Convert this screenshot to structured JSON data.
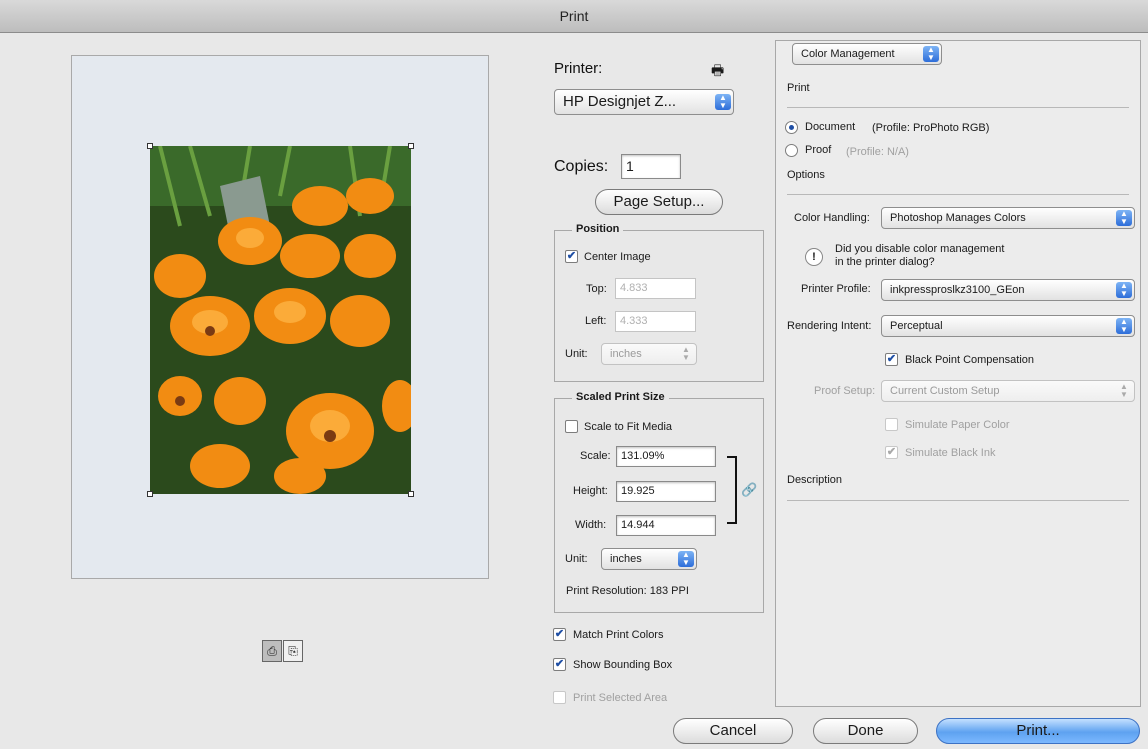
{
  "window": {
    "title": "Print"
  },
  "printer": {
    "label": "Printer:",
    "selected": "HP Designjet Z..."
  },
  "copies": {
    "label": "Copies:",
    "value": "1"
  },
  "page_setup_label": "Page Setup...",
  "position": {
    "title": "Position",
    "center_image_label": "Center Image",
    "top_label": "Top:",
    "top_value": "4.833",
    "left_label": "Left:",
    "left_value": "4.333",
    "unit_label": "Unit:",
    "unit_value": "inches"
  },
  "scaled_print_size": {
    "title": "Scaled Print Size",
    "scale_to_fit_label": "Scale to Fit Media",
    "scale_label": "Scale:",
    "scale_value": "131.09%",
    "height_label": "Height:",
    "height_value": "19.925",
    "width_label": "Width:",
    "width_value": "14.944",
    "unit_label": "Unit:",
    "unit_value": "inches",
    "print_resolution": "Print Resolution: 183 PPI"
  },
  "options_left": {
    "match_print_colors": "Match Print Colors",
    "show_bounding_box": "Show Bounding Box",
    "print_selected_area": "Print Selected Area"
  },
  "color_management": {
    "section_popup": "Color Management",
    "print_heading": "Print",
    "document_label": "Document",
    "document_profile": "(Profile: ProPhoto RGB)",
    "proof_label": "Proof",
    "proof_profile": "(Profile: N/A)",
    "options_heading": "Options",
    "color_handling_label": "Color Handling:",
    "color_handling_value": "Photoshop Manages Colors",
    "warning_line1": "Did you disable color management",
    "warning_line2": "in the printer dialog?",
    "printer_profile_label": "Printer Profile:",
    "printer_profile_value": "inkpressproslkz3100_GEon",
    "rendering_intent_label": "Rendering Intent:",
    "rendering_intent_value": "Perceptual",
    "black_point_label": "Black Point Compensation",
    "proof_setup_label": "Proof Setup:",
    "proof_setup_value": "Current Custom Setup",
    "simulate_paper_label": "Simulate Paper Color",
    "simulate_black_label": "Simulate Black Ink",
    "description_heading": "Description"
  },
  "buttons": {
    "cancel": "Cancel",
    "done": "Done",
    "print": "Print..."
  },
  "colors": {
    "accent": "#2e6ed9",
    "flower": "#f08a10",
    "foliage": "#2f5a20"
  }
}
